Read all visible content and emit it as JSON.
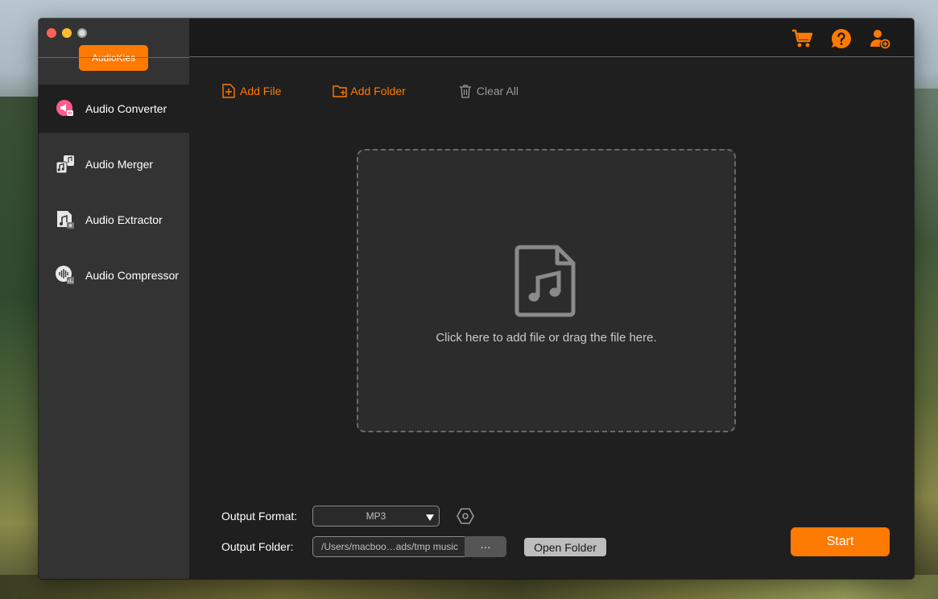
{
  "app": {
    "brand_label": "AudioKies"
  },
  "colors": {
    "accent": "#ff7a00",
    "sidebar_bg": "#333333",
    "main_bg": "#1f1f1f"
  },
  "sidebar": {
    "items": [
      {
        "label": "Audio Converter",
        "icon": "audio-converter-icon",
        "active": true
      },
      {
        "label": "Audio Merger",
        "icon": "audio-merger-icon",
        "active": false
      },
      {
        "label": "Audio Extractor",
        "icon": "audio-extractor-icon",
        "active": false
      },
      {
        "label": "Audio Compressor",
        "icon": "audio-compressor-icon",
        "active": false
      }
    ]
  },
  "topbar": {
    "icons": [
      "cart-icon",
      "help-icon",
      "add-user-icon"
    ]
  },
  "toolbar": {
    "add_file": "Add File",
    "add_folder": "Add Folder",
    "clear_all": "Clear All"
  },
  "dropzone": {
    "text": "Click here to add file or drag the file here."
  },
  "output": {
    "format_label": "Output Format:",
    "format_value": "MP3",
    "folder_label": "Output Folder:",
    "folder_value": "/Users/macboo…ads/tmp music",
    "browse_label": "···",
    "open_folder": "Open Folder"
  },
  "start_label": "Start"
}
